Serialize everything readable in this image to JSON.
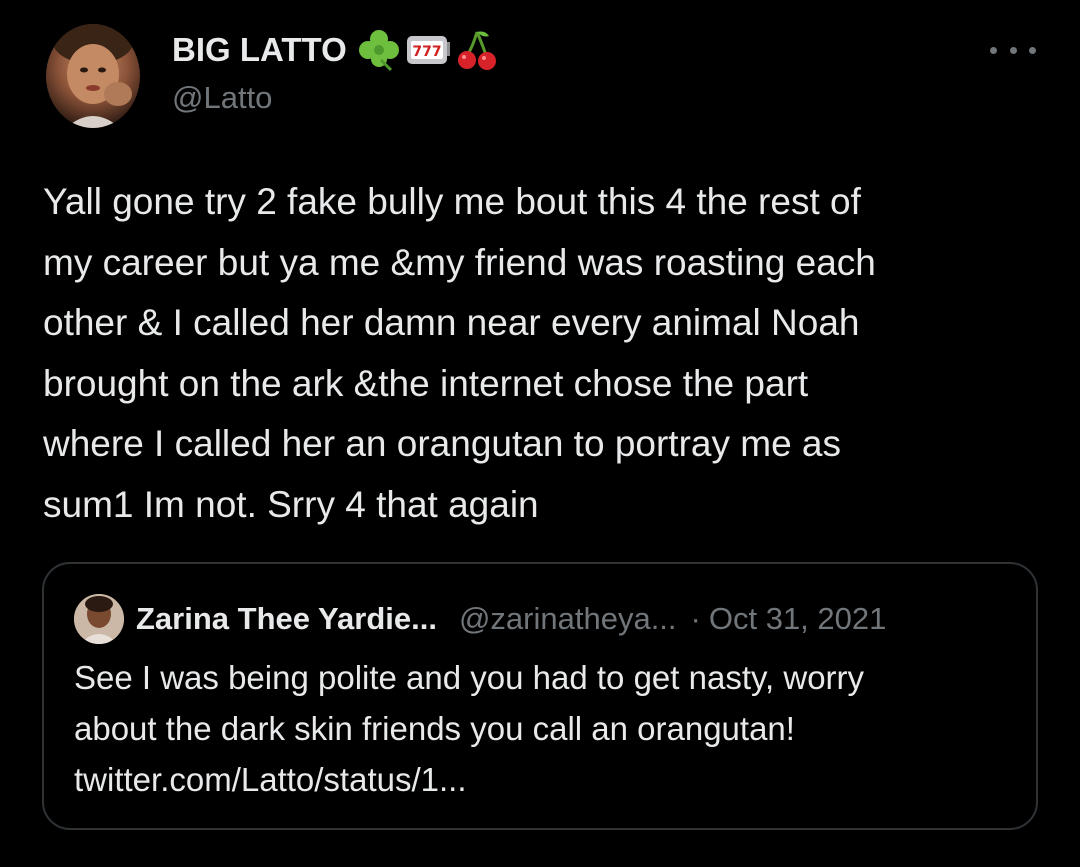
{
  "tweet": {
    "author": {
      "name": "BIG LATTO",
      "handle": "@Latto",
      "name_emojis": [
        "shamrock-icon",
        "slot-machine-icon",
        "cherries-icon"
      ]
    },
    "text_lines": [
      "Yall gone try 2 fake bully me bout this 4 the rest of",
      "my career but ya me &my friend was roasting each",
      "other & I called her damn near every animal Noah",
      "brought on the ark &the internet chose the part",
      "where I called her an orangutan to portray me as",
      "sum1 Im not. Srry 4 that again"
    ],
    "quote": {
      "name": "Zarina Thee Yardie...",
      "handle": "@zarinatheya...",
      "separator": "·",
      "date": "Oct 31, 2021",
      "text_lines": [
        "See I was being polite and you had to get nasty, worry",
        "about the dark skin friends you call an orangutan!",
        "twitter.com/Latto/status/1..."
      ]
    }
  },
  "colors": {
    "background": "#000000",
    "primary_text": "#e7e9ea",
    "secondary_text": "#71767b",
    "border": "#2f3336"
  }
}
